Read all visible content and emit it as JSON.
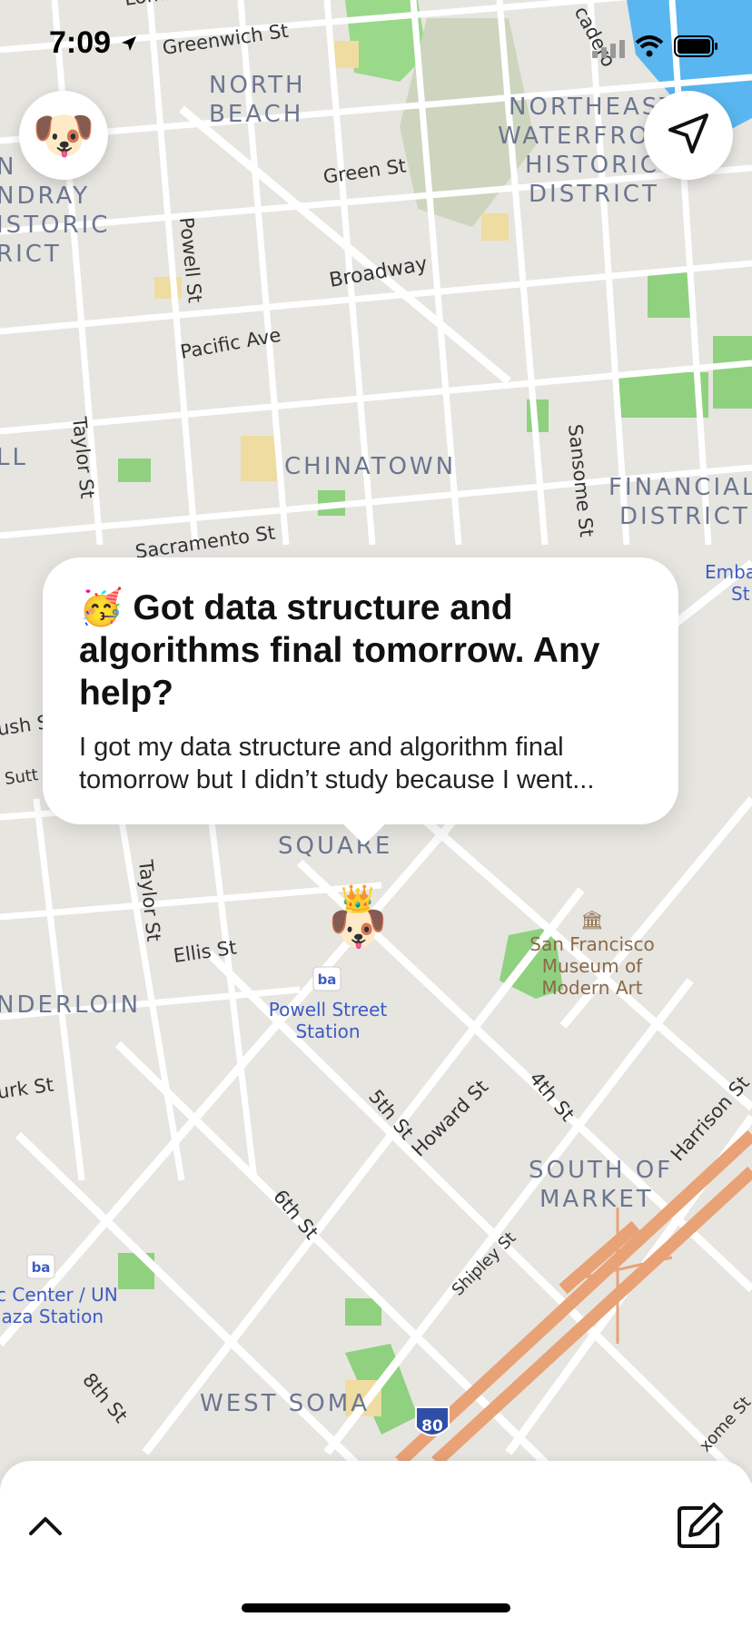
{
  "status_bar": {
    "time": "7:09"
  },
  "map": {
    "districts": [
      {
        "line1": "NORTH",
        "line2": "BEACH"
      },
      {
        "line1": "NORTHEAST",
        "line2": "WATERFRONT",
        "line3": "HISTORIC",
        "line4": "DISTRICT"
      },
      {
        "line1": "N",
        "line2": "NDRAY",
        "line3": "ISTORIC",
        "line4": "RICT"
      },
      {
        "line1": "CHINATOWN"
      },
      {
        "line1": "FINANCIAL",
        "line2": "DISTRICT"
      },
      {
        "line1": "SQUARE"
      },
      {
        "line1": "NDERLOIN"
      },
      {
        "line1": "SOUTH OF",
        "line2": "MARKET"
      },
      {
        "line1": "WEST SOMA"
      },
      {
        "line1": "LL"
      }
    ],
    "streets": [
      "Greenwich St",
      "Green St",
      "Powell St",
      "Broadway",
      "Pacific Ave",
      "Taylor St",
      "Sansome St",
      "Sacramento St",
      "Ellis St",
      "Taylor St",
      "5th St",
      "Howard St",
      "4th St",
      "Harrison St",
      "6th St",
      "Shipley St",
      "8th St",
      "urk St",
      "ush S",
      "Sutt",
      "cadero",
      "Lomb",
      "xome St"
    ],
    "pois": [
      {
        "name_line1": "San Francisco",
        "name_line2": "Museum of",
        "name_line3": "Modern Art"
      },
      {
        "name_line1": "Powell Street",
        "name_line2": "Station"
      },
      {
        "name_line1": "c Center / UN",
        "name_line2": "laza Station"
      },
      {
        "name_line1": "Emba",
        "name_line2": "St"
      }
    ],
    "highway_shield": "80",
    "transit_badge": "ba"
  },
  "post": {
    "emoji": "🥳",
    "title": "Got data structure and algorithms final tomorrow. Any help?",
    "body": "I got my data structure and algorithm final tomorrow but I didn’t study because I went..."
  },
  "marker": {
    "avatar": "🐶",
    "crown": "👑"
  },
  "profile_avatar": "🐶",
  "icons": [
    "location-arrow-icon",
    "signal-icon",
    "wifi-icon",
    "battery-icon",
    "navigate-icon",
    "chevron-up-icon",
    "compose-icon"
  ],
  "colors": {
    "park": "#8fd17f",
    "road": "#ffffff",
    "land": "#e8e6e1",
    "water": "#59b6f0",
    "highway": "#e8a276",
    "label": "#6b7690",
    "poi": "#8a6a4a",
    "transit": "#3d5cc4"
  }
}
